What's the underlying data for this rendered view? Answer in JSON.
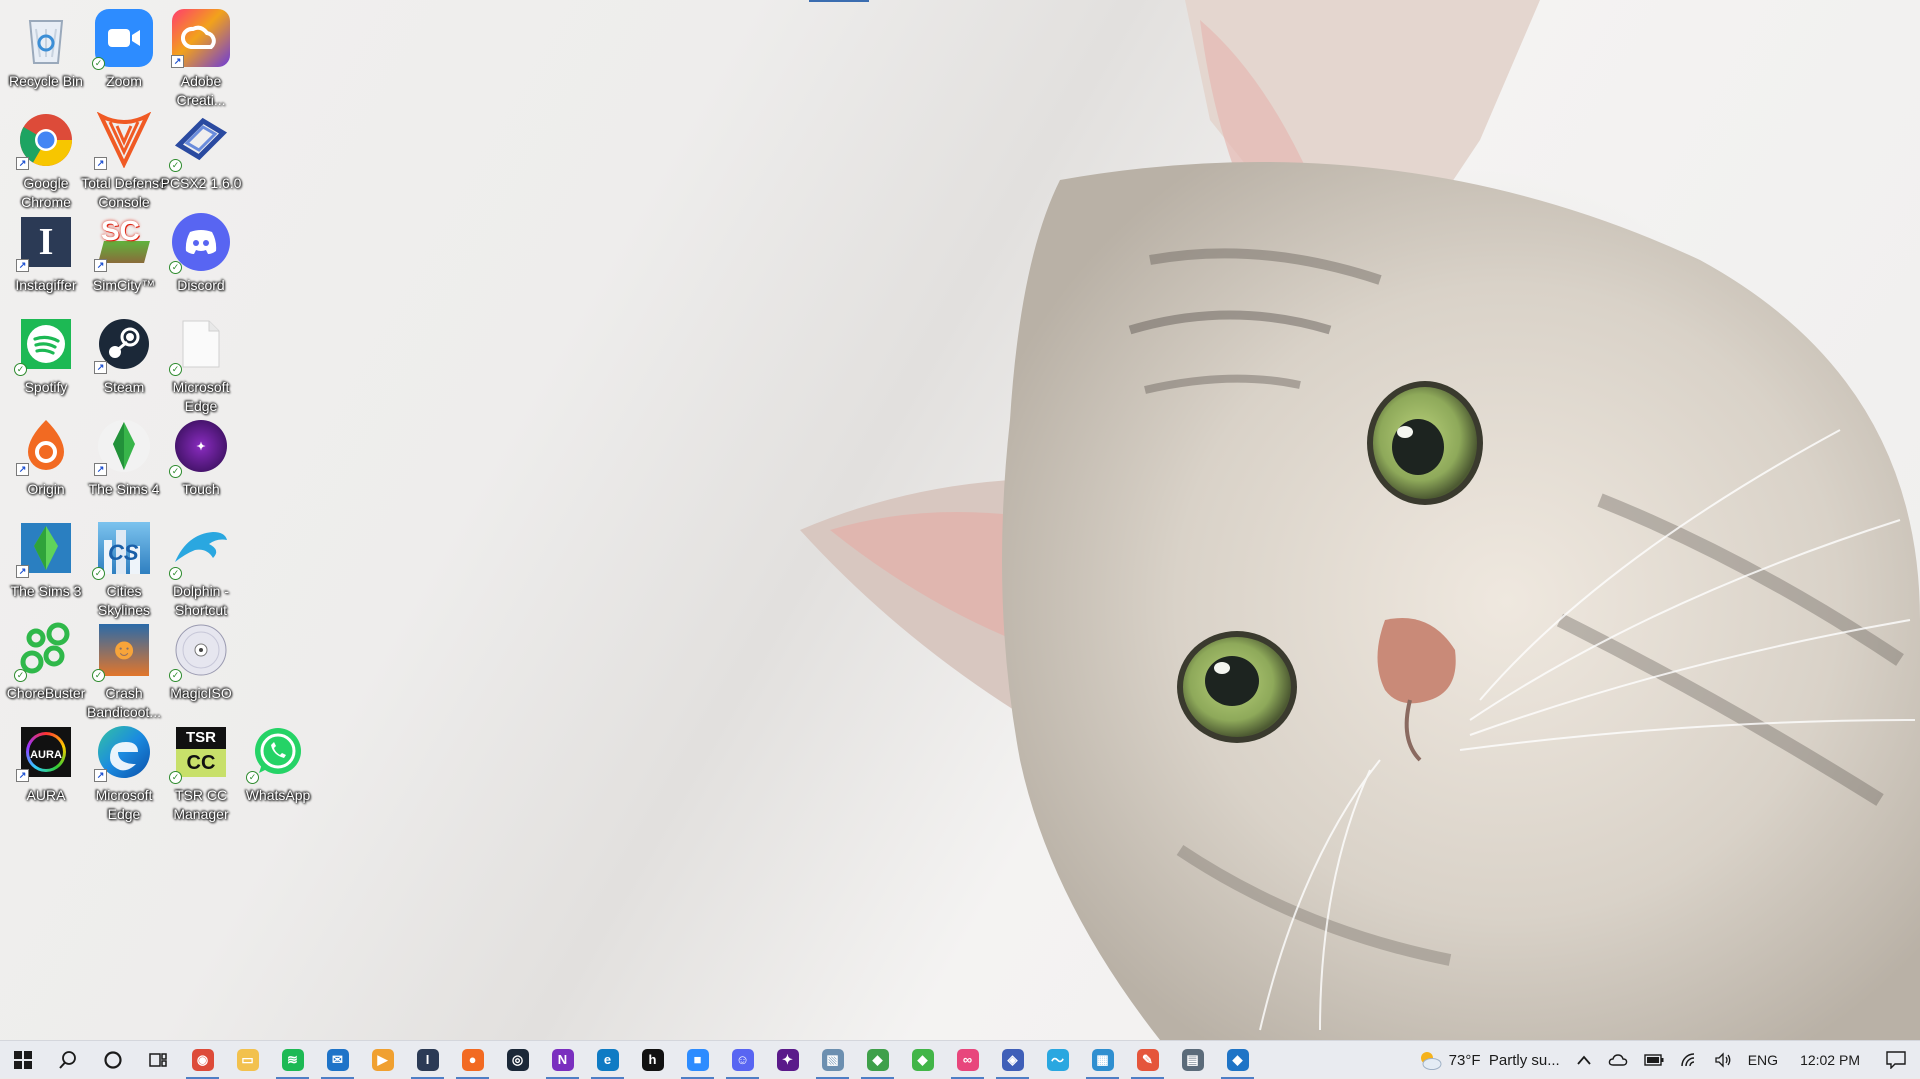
{
  "desktop": {
    "icons": [
      {
        "label": "Recycle Bin",
        "icon": "recycle-bin-icon",
        "badge": "none"
      },
      {
        "label": "Zoom",
        "icon": "zoom-icon",
        "badge": "sync"
      },
      {
        "label": "Adobe Creati...",
        "icon": "adobe-creative-cloud-icon",
        "badge": "link"
      },
      {
        "label": "Google Chrome",
        "icon": "chrome-icon",
        "badge": "link"
      },
      {
        "label": "Total Defense Console",
        "icon": "total-defense-icon",
        "badge": "link"
      },
      {
        "label": "PCSX2 1.6.0",
        "icon": "pcsx2-icon",
        "badge": "sync"
      },
      {
        "label": "Instagiffer",
        "icon": "instagiffer-icon",
        "badge": "link"
      },
      {
        "label": "SimCity™",
        "icon": "simcity-icon",
        "badge": "link"
      },
      {
        "label": "Discord",
        "icon": "discord-icon",
        "badge": "sync"
      },
      {
        "label": "Spotify",
        "icon": "spotify-icon",
        "badge": "sync"
      },
      {
        "label": "Steam",
        "icon": "steam-icon",
        "badge": "link"
      },
      {
        "label": "Microsoft Edge",
        "icon": "blank-file-icon",
        "badge": "sync"
      },
      {
        "label": "Origin",
        "icon": "origin-icon",
        "badge": "link"
      },
      {
        "label": "The Sims 4",
        "icon": "sims4-icon",
        "badge": "link"
      },
      {
        "label": "Touch",
        "icon": "touch-icon",
        "badge": "sync"
      },
      {
        "label": "The Sims 3",
        "icon": "sims3-icon",
        "badge": "link"
      },
      {
        "label": "Cities Skylines",
        "icon": "cities-skylines-icon",
        "badge": "sync"
      },
      {
        "label": "Dolphin - Shortcut",
        "icon": "dolphin-icon",
        "badge": "sync"
      },
      {
        "label": "ChoreBuster",
        "icon": "chorebuster-icon",
        "badge": "sync"
      },
      {
        "label": "Crash Bandicoot...",
        "icon": "crash-bandicoot-icon",
        "badge": "sync"
      },
      {
        "label": "MagicISO",
        "icon": "magiciso-icon",
        "badge": "sync"
      },
      {
        "label": "AURA",
        "icon": "aura-icon",
        "badge": "link"
      },
      {
        "label": "Microsoft Edge",
        "icon": "edge-icon",
        "badge": "link"
      },
      {
        "label": "TSR CC Manager",
        "icon": "tsr-cc-manager-icon",
        "badge": "sync"
      },
      {
        "label": "WhatsApp",
        "icon": "whatsapp-icon",
        "badge": "sync"
      }
    ],
    "icon_glyphs": {
      "instagiffer": "I",
      "simcity": "SC",
      "cities": "CS",
      "aura": "AURA",
      "tsr_top": "TSR",
      "tsr_bottom": "CC"
    }
  },
  "taskbar": {
    "apps": [
      {
        "name": "chrome",
        "color": "#dd4b39"
      },
      {
        "name": "file-explorer",
        "color": "#f2c14e"
      },
      {
        "name": "spotify",
        "color": "#1db954"
      },
      {
        "name": "mail",
        "color": "#1e73c8"
      },
      {
        "name": "media-player",
        "color": "#f0a030"
      },
      {
        "name": "instagiffer",
        "color": "#2b3a55"
      },
      {
        "name": "origin",
        "color": "#f26a22"
      },
      {
        "name": "steam",
        "color": "#1b2838"
      },
      {
        "name": "onenote",
        "color": "#7a2fbf"
      },
      {
        "name": "edge",
        "color": "#0f7bc4"
      },
      {
        "name": "hulu",
        "color": "#111111"
      },
      {
        "name": "zoom",
        "color": "#2d8cff"
      },
      {
        "name": "discord",
        "color": "#5865f2"
      },
      {
        "name": "touch",
        "color": "#5a1a8a"
      },
      {
        "name": "photo-viewer",
        "color": "#6c8fb0"
      },
      {
        "name": "sims3",
        "color": "#3fa04a"
      },
      {
        "name": "sims4",
        "color": "#42b548"
      },
      {
        "name": "adobe-cc",
        "color": "#e8467c"
      },
      {
        "name": "pcsx2",
        "color": "#3f5fb8"
      },
      {
        "name": "dolphin",
        "color": "#2aa7e0"
      },
      {
        "name": "cities-skylines",
        "color": "#2f8fd0"
      },
      {
        "name": "paint",
        "color": "#e5553b"
      },
      {
        "name": "calculator",
        "color": "#5b6b7a"
      },
      {
        "name": "kodi",
        "color": "#1f74c6"
      }
    ],
    "weather": {
      "temp": "73°F",
      "condition": "Partly su..."
    },
    "language": "ENG",
    "clock": "12:02 PM"
  }
}
